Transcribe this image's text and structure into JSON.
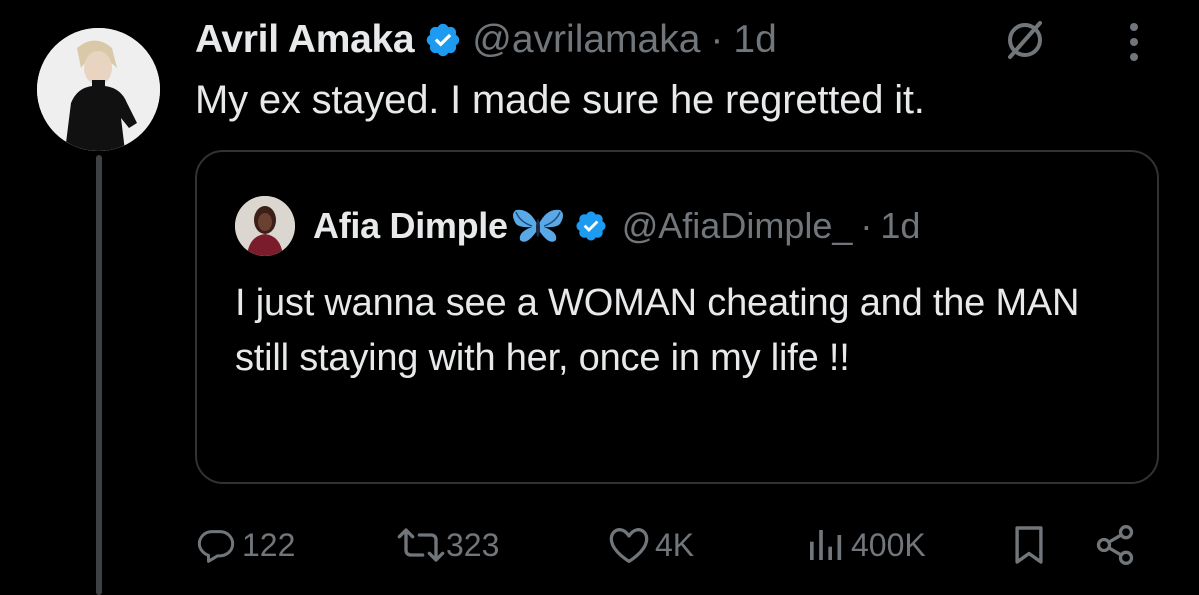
{
  "tweet": {
    "author_name": "Avril Amaka",
    "handle": "@avrilamaka",
    "separator": "·",
    "time": "1d",
    "text": "My ex stayed. I made sure he regretted it."
  },
  "quoted": {
    "author_name": "Afia Dimple",
    "handle": "@AfiaDimple_",
    "separator": "·",
    "time": "1d",
    "text": "I just wanna see a WOMAN cheating and the MAN still staying with her, once in my life !!"
  },
  "actions": {
    "replies": "122",
    "reposts": "323",
    "likes": "4K",
    "views": "400K"
  },
  "colors": {
    "background": "#000000",
    "text": "#e7e9ea",
    "secondary": "#71767b",
    "verified": "#1d9bf0",
    "border": "#2f3336",
    "thread_line": "#3e4144"
  },
  "icons": [
    "verified-badge-icon",
    "grok-icon",
    "more-icon",
    "butterfly-icon",
    "reply-icon",
    "repost-icon",
    "like-icon",
    "views-icon",
    "bookmark-icon",
    "share-icon"
  ]
}
